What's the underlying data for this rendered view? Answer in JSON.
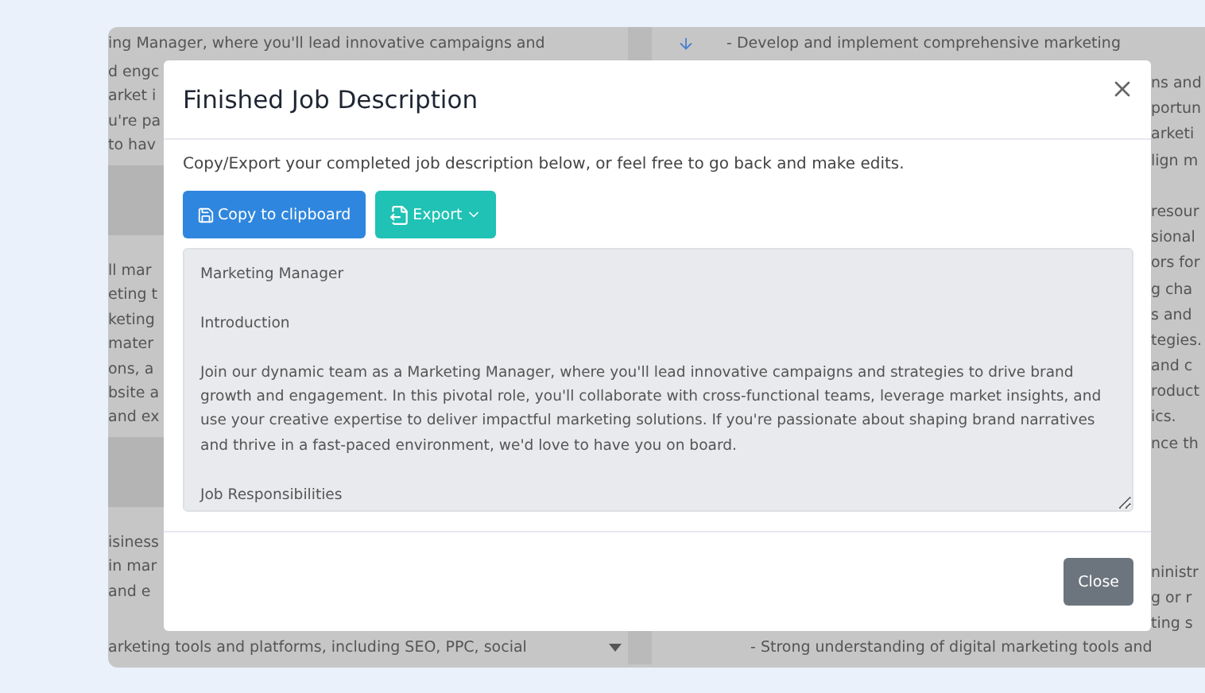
{
  "background": {
    "left_top": "ing Manager, where you'll lead innovative campaigns and",
    "right_top": "- Develop and implement comprehensive marketing",
    "left_lines": [
      {
        "kind": "text",
        "text": "d engc"
      },
      {
        "kind": "text",
        "text": "arket i"
      },
      {
        "kind": "text",
        "text": "u're pa"
      },
      {
        "kind": "text",
        "text": "to hav"
      },
      {
        "kind": "band"
      },
      {
        "kind": "gap"
      },
      {
        "kind": "text",
        "text": "ll mar"
      },
      {
        "kind": "text",
        "text": "eting t"
      },
      {
        "kind": "text",
        "text": "keting"
      },
      {
        "kind": "text",
        "text": "mater"
      },
      {
        "kind": "text",
        "text": "ons, a"
      },
      {
        "kind": "text",
        "text": "bsite a"
      },
      {
        "kind": "text",
        "text": "and ex"
      },
      {
        "kind": "band"
      },
      {
        "kind": "gap"
      },
      {
        "kind": "text",
        "text": "isiness"
      },
      {
        "kind": "text",
        "text": "in mar"
      },
      {
        "kind": "text",
        "text": "and e"
      }
    ],
    "right_lines": [
      {
        "kind": "text",
        "text": "ns and"
      },
      {
        "kind": "text",
        "text": "portun"
      },
      {
        "kind": "text",
        "text": "arketi"
      },
      {
        "kind": "text",
        "text": "lign m"
      },
      {
        "kind": "gap"
      },
      {
        "kind": "text",
        "text": "resour"
      },
      {
        "kind": "text",
        "text": "sional"
      },
      {
        "kind": "text",
        "text": "ors for"
      },
      {
        "kind": "text",
        "text": "g cha"
      },
      {
        "kind": "text",
        "text": "s and"
      },
      {
        "kind": "text",
        "text": "tegies."
      },
      {
        "kind": "text",
        "text": "and c"
      },
      {
        "kind": "text",
        "text": "roduct"
      },
      {
        "kind": "text",
        "text": "ics."
      },
      {
        "kind": "text",
        "text": "nce th"
      },
      {
        "kind": "gap"
      },
      {
        "kind": "gap"
      },
      {
        "kind": "gap"
      },
      {
        "kind": "gap"
      },
      {
        "kind": "text",
        "text": "ninistr"
      },
      {
        "kind": "text",
        "text": "g or r"
      },
      {
        "kind": "text",
        "text": "ting s"
      }
    ],
    "left_bottom": "arketing tools and platforms, including SEO, PPC, social",
    "right_bottom": "- Strong understanding of digital marketing tools and"
  },
  "modal": {
    "title": "Finished Job Description",
    "intro": "Copy/Export your completed job description below, or feel free to go back and make edits.",
    "copy_button": "Copy to clipboard",
    "export_button": "Export",
    "description": {
      "value": [
        "Marketing Manager",
        "Introduction",
        "Join our dynamic team as a Marketing Manager, where you'll lead innovative campaigns and strategies to drive brand growth and engagement. In this pivotal role, you'll collaborate with cross-functional teams, leverage market insights, and use your creative expertise to deliver impactful marketing solutions. If you're passionate about shaping brand narratives and thrive in a fast-paced environment, we'd love to have you on board.",
        "Job Responsibilities"
      ]
    },
    "close_button": "Close"
  }
}
